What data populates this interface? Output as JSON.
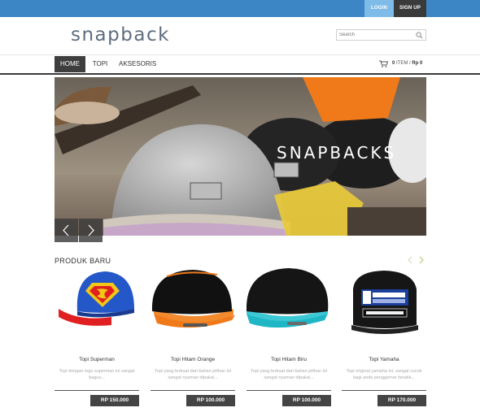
{
  "topbar": {
    "login_label": "LOGIN",
    "signup_label": "SIGN UP"
  },
  "header": {
    "logo": "snapback",
    "search_placeholder": "Search"
  },
  "nav": {
    "items": [
      {
        "label": "HOME"
      },
      {
        "label": "TOPI"
      },
      {
        "label": "AKSESORIS"
      }
    ]
  },
  "cart": {
    "count": "0",
    "item_label": "ITEM",
    "separator": "/",
    "currency": "Rp",
    "amount": "0"
  },
  "banner": {
    "text": "SNAPBACKS"
  },
  "section": {
    "title": "PRODUK BARU"
  },
  "products": [
    {
      "name": "Topi Superman",
      "desc": "Topi dengan logo superman ini sangat bagus...",
      "price": "RP 150.000"
    },
    {
      "name": "Topi Hitam Orange",
      "desc": "Topi yang terbuat dari bahan pilihan ini sangat nyaman dipakai...",
      "price": "RP 100.000"
    },
    {
      "name": "Topi Hitam Biru",
      "desc": "Topi yang terbuat dari bahan pilihan ini sangat nyaman dipakai...",
      "price": "RP 100.000"
    },
    {
      "name": "Topi Yamaha",
      "desc": "Topi original yamaha ini, sangat cocok bagi anda penggemar fanatik...",
      "price": "RP 170.000"
    }
  ],
  "colors": {
    "topbar": "#3d86c6",
    "login_bg": "#7fbbe8",
    "dark": "#3a3a3a",
    "accent_orange": "#f07a1a",
    "accent_yellow": "#e8c93a",
    "arrow_green": "#b8c77a"
  },
  "icons": {
    "search": "search-icon",
    "cart": "cart-icon",
    "prev": "chevron-left-icon",
    "next": "chevron-right-icon"
  }
}
